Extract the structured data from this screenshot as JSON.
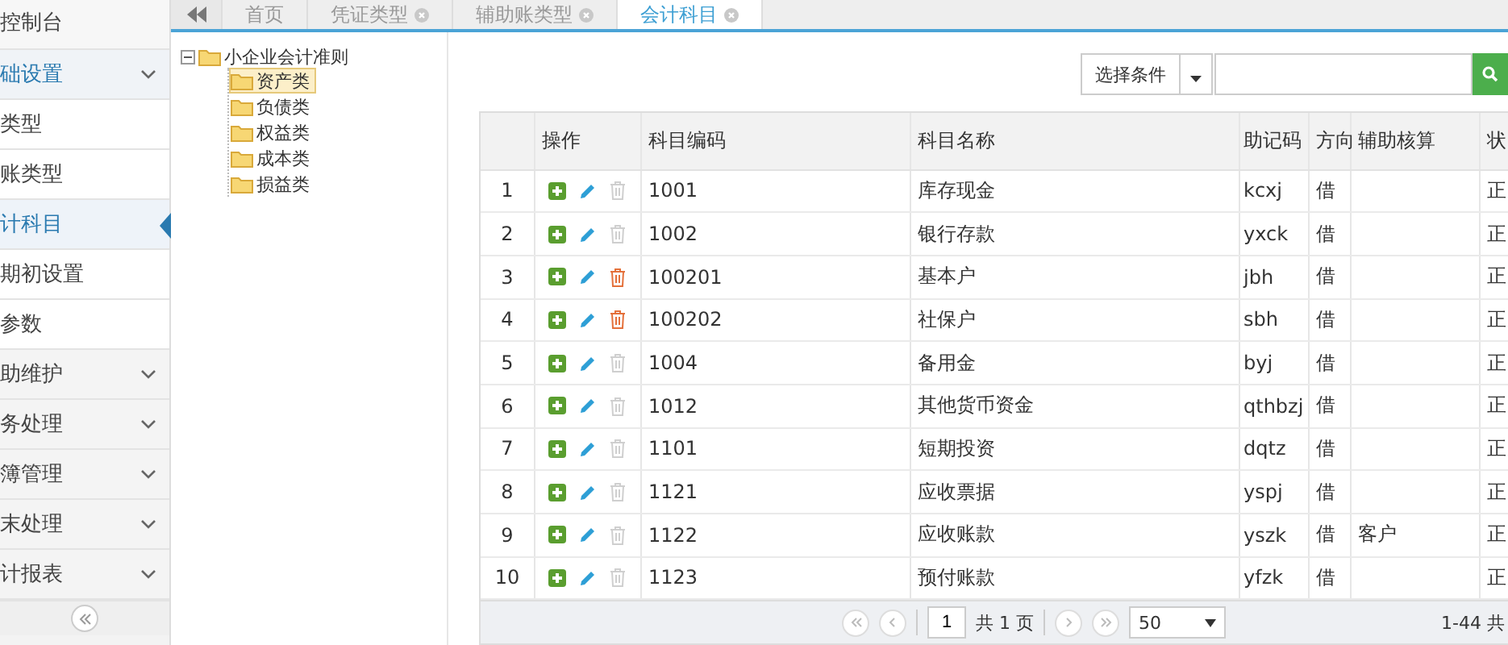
{
  "sidebar": {
    "items": [
      {
        "label": "控制台",
        "kind": "plain"
      },
      {
        "label": "础设置",
        "kind": "group",
        "expanded": true,
        "children": [
          {
            "label": "类型",
            "selected": false
          },
          {
            "label": "账类型",
            "selected": false
          },
          {
            "label": "计科目",
            "selected": true
          },
          {
            "label": "期初设置",
            "selected": false
          },
          {
            "label": "参数",
            "selected": false
          }
        ]
      },
      {
        "label": "助维护",
        "kind": "group",
        "expanded": false
      },
      {
        "label": "务处理",
        "kind": "group",
        "expanded": false
      },
      {
        "label": "簿管理",
        "kind": "group",
        "expanded": false
      },
      {
        "label": "末处理",
        "kind": "group",
        "expanded": false
      },
      {
        "label": "计报表",
        "kind": "group",
        "expanded": false
      }
    ]
  },
  "tabs": [
    {
      "label": "首页",
      "closable": false,
      "selected": false
    },
    {
      "label": "凭证类型",
      "closable": true,
      "selected": false
    },
    {
      "label": "辅助账类型",
      "closable": true,
      "selected": false
    },
    {
      "label": "会计科目",
      "closable": true,
      "selected": true
    }
  ],
  "tree": {
    "label": "小企业会计准则",
    "expanded": true,
    "children": [
      {
        "label": "资产类",
        "selected": true
      },
      {
        "label": "负债类",
        "selected": false
      },
      {
        "label": "权益类",
        "selected": false
      },
      {
        "label": "成本类",
        "selected": false
      },
      {
        "label": "损益类",
        "selected": false
      }
    ]
  },
  "filter": {
    "label": "选择条件"
  },
  "table": {
    "columns": [
      "",
      "操作",
      "科目编码",
      "科目名称",
      "助记码",
      "方向",
      "辅助核算",
      "状"
    ],
    "rows": [
      {
        "index": "1",
        "code": "1001",
        "name": "库存现金",
        "mnemonic": "kcxj",
        "direction": "借",
        "auxiliary": "",
        "status": "正",
        "deletable": false
      },
      {
        "index": "2",
        "code": "1002",
        "name": "银行存款",
        "mnemonic": "yxck",
        "direction": "借",
        "auxiliary": "",
        "status": "正",
        "deletable": false
      },
      {
        "index": "3",
        "code": "100201",
        "name": "基本户",
        "mnemonic": "jbh",
        "direction": "借",
        "auxiliary": "",
        "status": "正",
        "deletable": true
      },
      {
        "index": "4",
        "code": "100202",
        "name": "社保户",
        "mnemonic": "sbh",
        "direction": "借",
        "auxiliary": "",
        "status": "正",
        "deletable": true
      },
      {
        "index": "5",
        "code": "1004",
        "name": "备用金",
        "mnemonic": "byj",
        "direction": "借",
        "auxiliary": "",
        "status": "正",
        "deletable": false
      },
      {
        "index": "6",
        "code": "1012",
        "name": "其他货币资金",
        "mnemonic": "qthbzj",
        "direction": "借",
        "auxiliary": "",
        "status": "正",
        "deletable": false
      },
      {
        "index": "7",
        "code": "1101",
        "name": "短期投资",
        "mnemonic": "dqtz",
        "direction": "借",
        "auxiliary": "",
        "status": "正",
        "deletable": false
      },
      {
        "index": "8",
        "code": "1121",
        "name": "应收票据",
        "mnemonic": "yspj",
        "direction": "借",
        "auxiliary": "",
        "status": "正",
        "deletable": false
      },
      {
        "index": "9",
        "code": "1122",
        "name": "应收账款",
        "mnemonic": "yszk",
        "direction": "借",
        "auxiliary": "客户",
        "status": "正",
        "deletable": false
      },
      {
        "index": "10",
        "code": "1123",
        "name": "预付账款",
        "mnemonic": "yfzk",
        "direction": "借",
        "auxiliary": "",
        "status": "正",
        "deletable": false
      }
    ]
  },
  "pagination": {
    "page": "1",
    "total_pages": "共 1 页",
    "page_size": "50",
    "summary": "1-44 共"
  }
}
